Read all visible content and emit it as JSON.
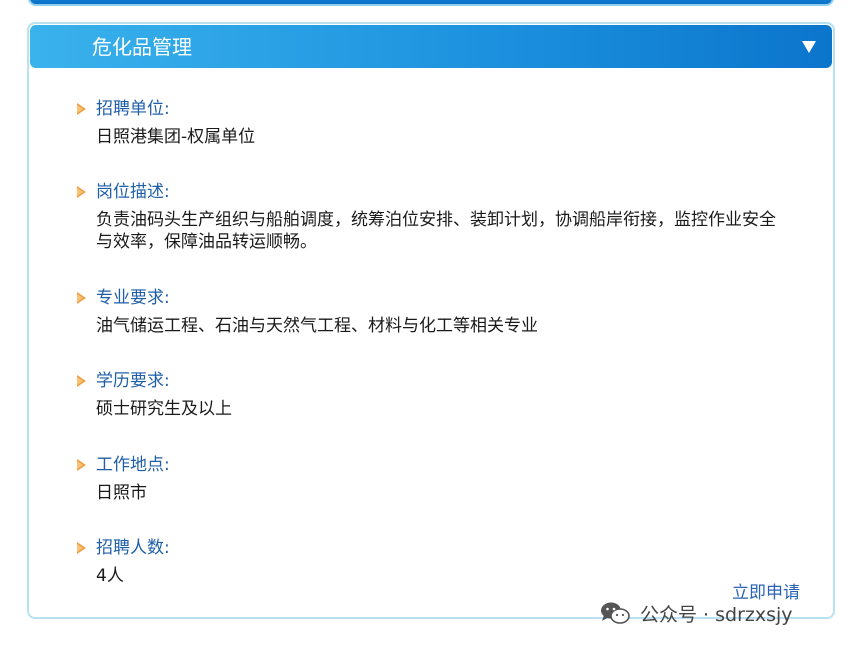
{
  "panel": {
    "title": "危化品管理",
    "collapse_icon": "triangle-down-icon"
  },
  "fields": [
    {
      "label": "招聘单位:",
      "value": "日照港集团-权属单位"
    },
    {
      "label": "岗位描述:",
      "value": "负责油码头生产组织与船舶调度，统筹泊位安排、装卸计划，协调船岸衔接，监控作业安全与效率，保障油品转运顺畅。"
    },
    {
      "label": "专业要求:",
      "value": "油气储运工程、石油与天然气工程、材料与化工等相关专业"
    },
    {
      "label": "学历要求:",
      "value": "硕士研究生及以上"
    },
    {
      "label": "工作地点:",
      "value": "日照市"
    },
    {
      "label": "招聘人数:",
      "value": "4人"
    }
  ],
  "apply_link": "立即申请",
  "watermark": {
    "text": "公众号 · sdrzxsjy",
    "icon": "wechat-icon"
  },
  "colors": {
    "header_start": "#3ab2ec",
    "header_end": "#0b75cc",
    "label": "#1f5fa8",
    "bullet": "#f0a040",
    "link": "#2a63b6"
  }
}
